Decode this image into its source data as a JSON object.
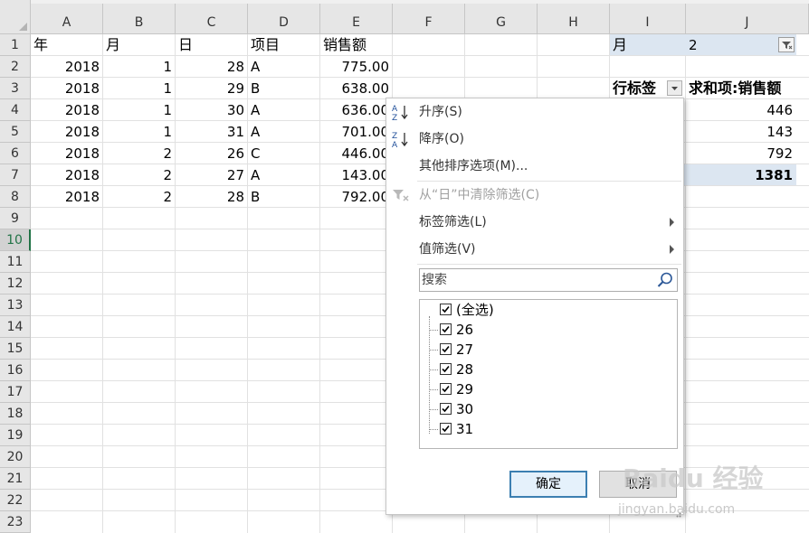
{
  "spreadsheet": {
    "columns": [
      "A",
      "B",
      "C",
      "D",
      "E",
      "F",
      "G",
      "H",
      "I",
      "J"
    ],
    "rows": [
      "1",
      "2",
      "3",
      "4",
      "5",
      "6",
      "7",
      "8",
      "9",
      "10",
      "11",
      "12",
      "13",
      "14",
      "15",
      "16",
      "17",
      "18",
      "19",
      "20",
      "21",
      "22",
      "23"
    ],
    "active_row": "10",
    "headers": [
      "年",
      "月",
      "日",
      "项目",
      "销售额"
    ],
    "data": [
      [
        "2018",
        "1",
        "28",
        "A",
        "775.00"
      ],
      [
        "2018",
        "1",
        "29",
        "B",
        "638.00"
      ],
      [
        "2018",
        "1",
        "30",
        "A",
        "636.00"
      ],
      [
        "2018",
        "1",
        "31",
        "A",
        "701.00"
      ],
      [
        "2018",
        "2",
        "26",
        "C",
        "446.00"
      ],
      [
        "2018",
        "2",
        "27",
        "A",
        "143.00"
      ],
      [
        "2018",
        "2",
        "28",
        "B",
        "792.00"
      ]
    ]
  },
  "pivot": {
    "filter_field": "月",
    "filter_value": "2",
    "row_label_header": "行标签",
    "value_header": "求和项:销售额",
    "values": [
      "446",
      "143",
      "792"
    ],
    "total": "1381"
  },
  "menu": {
    "sort_asc": "升序(S)",
    "sort_desc": "降序(O)",
    "more_sort": "其他排序选项(M)...",
    "clear_filter": "从“日”中清除筛选(C)",
    "label_filter": "标签筛选(L)",
    "value_filter": "值筛选(V)",
    "search_placeholder": "搜索",
    "items": [
      {
        "label": "(全选)",
        "checked": true
      },
      {
        "label": "26",
        "checked": true
      },
      {
        "label": "27",
        "checked": true
      },
      {
        "label": "28",
        "checked": true
      },
      {
        "label": "29",
        "checked": true
      },
      {
        "label": "30",
        "checked": true
      },
      {
        "label": "31",
        "checked": true
      }
    ],
    "ok_label": "确定",
    "cancel_label": "取消"
  },
  "watermark": {
    "text": "Baidu 经验",
    "sub": "jingyan.baidu.com"
  },
  "colors": {
    "accent_green": "#217346",
    "pivot_header_bg": "#dce6f1",
    "ok_border": "#3c7fb1"
  }
}
